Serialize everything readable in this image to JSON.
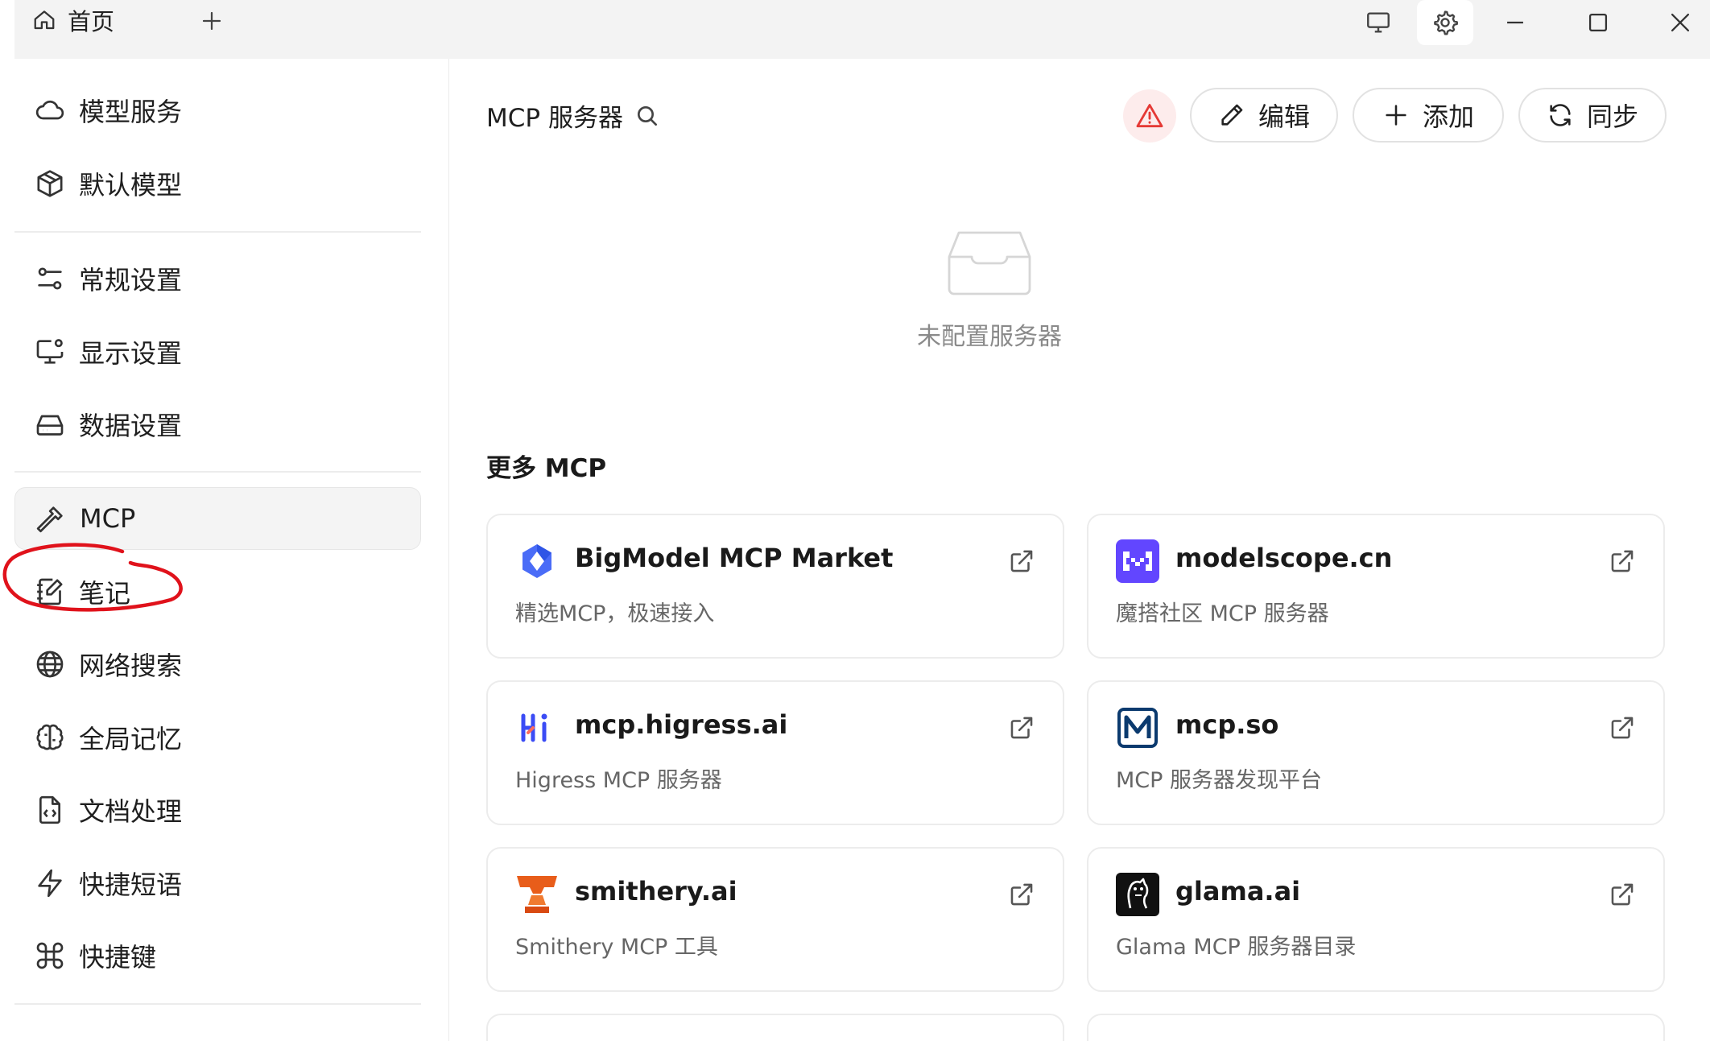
{
  "titlebar": {
    "home_tab_label": "首页"
  },
  "sidebar": {
    "items": [
      {
        "label": "模型服务",
        "icon": "cloud-icon"
      },
      {
        "label": "默认模型",
        "icon": "cube-icon"
      },
      {
        "label": "常规设置",
        "icon": "sliders-icon"
      },
      {
        "label": "显示设置",
        "icon": "monitor-settings-icon"
      },
      {
        "label": "数据设置",
        "icon": "hard-drive-icon"
      },
      {
        "label": "MCP",
        "icon": "hammer-icon"
      },
      {
        "label": "笔记",
        "icon": "notebook-icon"
      },
      {
        "label": "网络搜索",
        "icon": "globe-icon"
      },
      {
        "label": "全局记忆",
        "icon": "brain-icon"
      },
      {
        "label": "文档处理",
        "icon": "file-code-icon"
      },
      {
        "label": "快捷短语",
        "icon": "zap-icon"
      },
      {
        "label": "快捷键",
        "icon": "command-icon"
      }
    ],
    "active_item": "MCP"
  },
  "main": {
    "title": "MCP 服务器",
    "buttons": {
      "edit": "编辑",
      "add": "添加",
      "sync": "同步"
    },
    "empty_text": "未配置服务器",
    "more_section_title": "更多 MCP",
    "cards": [
      {
        "name": "BigModel MCP Market",
        "desc": "精选MCP，极速接入",
        "logo": "bigmodel-logo"
      },
      {
        "name": "modelscope.cn",
        "desc": "魔搭社区 MCP 服务器",
        "logo": "modelscope-logo"
      },
      {
        "name": "mcp.higress.ai",
        "desc": "Higress MCP 服务器",
        "logo": "higress-logo"
      },
      {
        "name": "mcp.so",
        "desc": "MCP 服务器发现平台",
        "logo": "mcpso-logo"
      },
      {
        "name": "smithery.ai",
        "desc": "Smithery MCP 工具",
        "logo": "smithery-logo"
      },
      {
        "name": "glama.ai",
        "desc": "Glama MCP 服务器目录",
        "logo": "glama-logo"
      }
    ]
  },
  "colors": {
    "accent_warning": "#e53935",
    "annotation_ring": "#e0121b",
    "titlebar_bg": "#f3f3f3"
  }
}
